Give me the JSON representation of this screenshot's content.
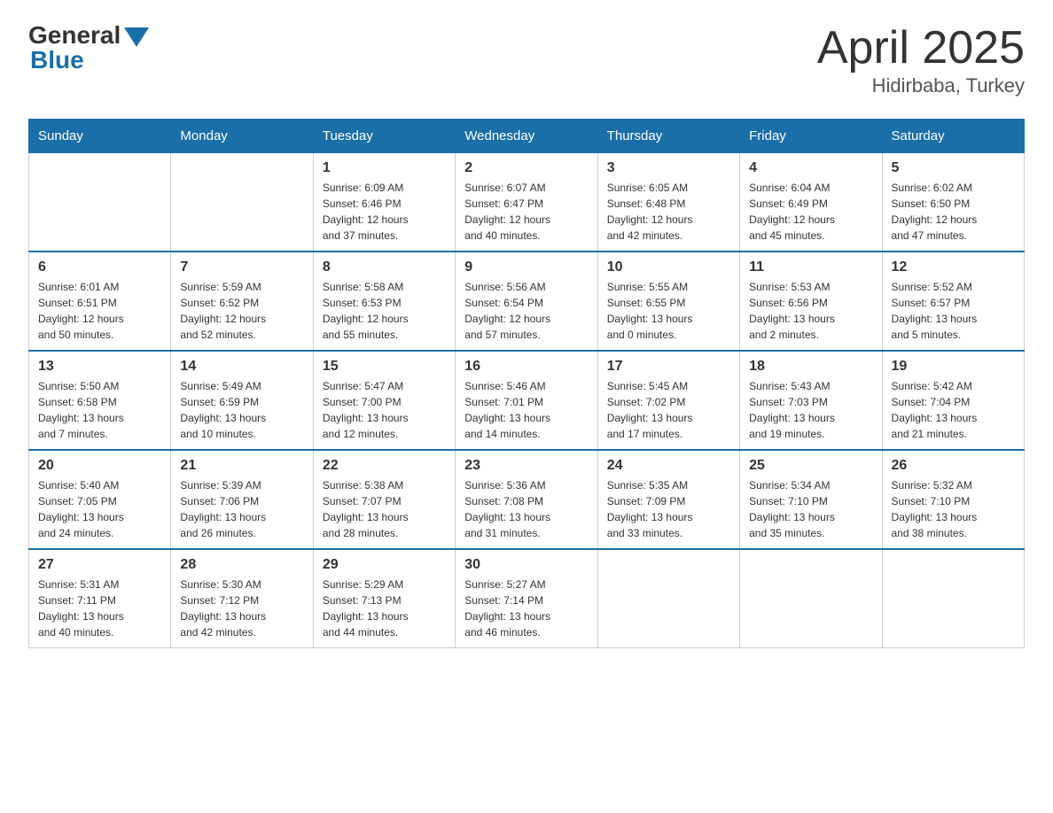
{
  "header": {
    "logo_general": "General",
    "logo_blue": "Blue",
    "month_title": "April 2025",
    "location": "Hidirbaba, Turkey"
  },
  "weekdays": [
    "Sunday",
    "Monday",
    "Tuesday",
    "Wednesday",
    "Thursday",
    "Friday",
    "Saturday"
  ],
  "weeks": [
    [
      {
        "day": "",
        "info": ""
      },
      {
        "day": "",
        "info": ""
      },
      {
        "day": "1",
        "info": "Sunrise: 6:09 AM\nSunset: 6:46 PM\nDaylight: 12 hours\nand 37 minutes."
      },
      {
        "day": "2",
        "info": "Sunrise: 6:07 AM\nSunset: 6:47 PM\nDaylight: 12 hours\nand 40 minutes."
      },
      {
        "day": "3",
        "info": "Sunrise: 6:05 AM\nSunset: 6:48 PM\nDaylight: 12 hours\nand 42 minutes."
      },
      {
        "day": "4",
        "info": "Sunrise: 6:04 AM\nSunset: 6:49 PM\nDaylight: 12 hours\nand 45 minutes."
      },
      {
        "day": "5",
        "info": "Sunrise: 6:02 AM\nSunset: 6:50 PM\nDaylight: 12 hours\nand 47 minutes."
      }
    ],
    [
      {
        "day": "6",
        "info": "Sunrise: 6:01 AM\nSunset: 6:51 PM\nDaylight: 12 hours\nand 50 minutes."
      },
      {
        "day": "7",
        "info": "Sunrise: 5:59 AM\nSunset: 6:52 PM\nDaylight: 12 hours\nand 52 minutes."
      },
      {
        "day": "8",
        "info": "Sunrise: 5:58 AM\nSunset: 6:53 PM\nDaylight: 12 hours\nand 55 minutes."
      },
      {
        "day": "9",
        "info": "Sunrise: 5:56 AM\nSunset: 6:54 PM\nDaylight: 12 hours\nand 57 minutes."
      },
      {
        "day": "10",
        "info": "Sunrise: 5:55 AM\nSunset: 6:55 PM\nDaylight: 13 hours\nand 0 minutes."
      },
      {
        "day": "11",
        "info": "Sunrise: 5:53 AM\nSunset: 6:56 PM\nDaylight: 13 hours\nand 2 minutes."
      },
      {
        "day": "12",
        "info": "Sunrise: 5:52 AM\nSunset: 6:57 PM\nDaylight: 13 hours\nand 5 minutes."
      }
    ],
    [
      {
        "day": "13",
        "info": "Sunrise: 5:50 AM\nSunset: 6:58 PM\nDaylight: 13 hours\nand 7 minutes."
      },
      {
        "day": "14",
        "info": "Sunrise: 5:49 AM\nSunset: 6:59 PM\nDaylight: 13 hours\nand 10 minutes."
      },
      {
        "day": "15",
        "info": "Sunrise: 5:47 AM\nSunset: 7:00 PM\nDaylight: 13 hours\nand 12 minutes."
      },
      {
        "day": "16",
        "info": "Sunrise: 5:46 AM\nSunset: 7:01 PM\nDaylight: 13 hours\nand 14 minutes."
      },
      {
        "day": "17",
        "info": "Sunrise: 5:45 AM\nSunset: 7:02 PM\nDaylight: 13 hours\nand 17 minutes."
      },
      {
        "day": "18",
        "info": "Sunrise: 5:43 AM\nSunset: 7:03 PM\nDaylight: 13 hours\nand 19 minutes."
      },
      {
        "day": "19",
        "info": "Sunrise: 5:42 AM\nSunset: 7:04 PM\nDaylight: 13 hours\nand 21 minutes."
      }
    ],
    [
      {
        "day": "20",
        "info": "Sunrise: 5:40 AM\nSunset: 7:05 PM\nDaylight: 13 hours\nand 24 minutes."
      },
      {
        "day": "21",
        "info": "Sunrise: 5:39 AM\nSunset: 7:06 PM\nDaylight: 13 hours\nand 26 minutes."
      },
      {
        "day": "22",
        "info": "Sunrise: 5:38 AM\nSunset: 7:07 PM\nDaylight: 13 hours\nand 28 minutes."
      },
      {
        "day": "23",
        "info": "Sunrise: 5:36 AM\nSunset: 7:08 PM\nDaylight: 13 hours\nand 31 minutes."
      },
      {
        "day": "24",
        "info": "Sunrise: 5:35 AM\nSunset: 7:09 PM\nDaylight: 13 hours\nand 33 minutes."
      },
      {
        "day": "25",
        "info": "Sunrise: 5:34 AM\nSunset: 7:10 PM\nDaylight: 13 hours\nand 35 minutes."
      },
      {
        "day": "26",
        "info": "Sunrise: 5:32 AM\nSunset: 7:10 PM\nDaylight: 13 hours\nand 38 minutes."
      }
    ],
    [
      {
        "day": "27",
        "info": "Sunrise: 5:31 AM\nSunset: 7:11 PM\nDaylight: 13 hours\nand 40 minutes."
      },
      {
        "day": "28",
        "info": "Sunrise: 5:30 AM\nSunset: 7:12 PM\nDaylight: 13 hours\nand 42 minutes."
      },
      {
        "day": "29",
        "info": "Sunrise: 5:29 AM\nSunset: 7:13 PM\nDaylight: 13 hours\nand 44 minutes."
      },
      {
        "day": "30",
        "info": "Sunrise: 5:27 AM\nSunset: 7:14 PM\nDaylight: 13 hours\nand 46 minutes."
      },
      {
        "day": "",
        "info": ""
      },
      {
        "day": "",
        "info": ""
      },
      {
        "day": "",
        "info": ""
      }
    ]
  ]
}
